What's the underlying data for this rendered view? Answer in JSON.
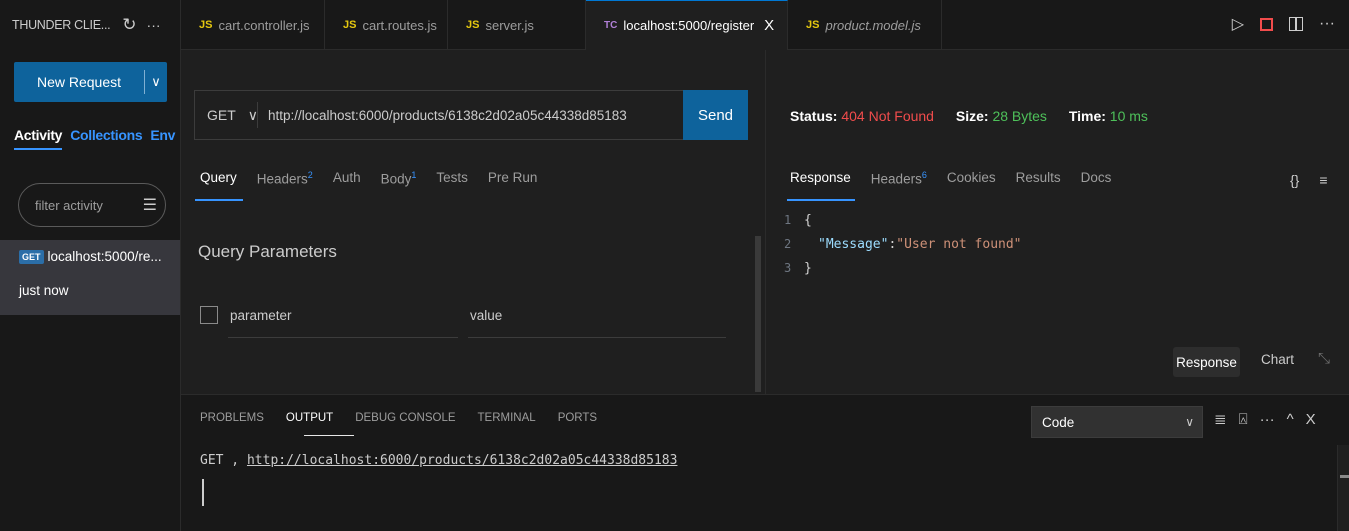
{
  "sidebar": {
    "title": "THUNDER CLIE...",
    "refresh_icon": "refresh-icon",
    "more_icon": "ellipsis-icon",
    "new_request_label": "New Request",
    "dropdown_glyph": "∨",
    "tabs": [
      "Activity",
      "Collections",
      "Env"
    ],
    "filter_placeholder": "filter activity",
    "activity": {
      "method": "GET",
      "label": "localhost:5000/re...",
      "time": "just now"
    }
  },
  "editor_tabs": [
    {
      "icon": "JS",
      "label": "cart.controller.js"
    },
    {
      "icon": "JS",
      "label": "cart.routes.js"
    },
    {
      "icon": "JS",
      "label": "server.js"
    },
    {
      "icon": "TC",
      "label": "localhost:5000/register",
      "active": true,
      "close": "X"
    },
    {
      "icon": "JS",
      "label": "product.model.js",
      "italic": true
    }
  ],
  "request": {
    "method": "GET",
    "url": "http://localhost:6000/products/6138c2d02a05c44338d85183",
    "send_label": "Send",
    "tabs": {
      "query": "Query",
      "headers": "Headers",
      "headers_count": "2",
      "auth": "Auth",
      "body": "Body",
      "body_count": "1",
      "tests": "Tests",
      "prerun": "Pre Run"
    },
    "query_title": "Query Parameters",
    "param_placeholder": "parameter",
    "value_placeholder": "value"
  },
  "response": {
    "status_label": "Status:",
    "status_value": "404 Not Found",
    "size_label": "Size:",
    "size_value": "28 Bytes",
    "time_label": "Time:",
    "time_value": "10 ms",
    "tabs": {
      "response": "Response",
      "headers": "Headers",
      "headers_count": "6",
      "cookies": "Cookies",
      "results": "Results",
      "docs": "Docs"
    },
    "braces_icon": "{}",
    "menu_icon": "≡",
    "code": {
      "line1": "{",
      "key": "\"Message\"",
      "colon": ": ",
      "value": "\"User not found\"",
      "line3": "}"
    },
    "view_response": "Response",
    "view_chart": "Chart"
  },
  "panel": {
    "tabs": [
      "PROBLEMS",
      "OUTPUT",
      "DEBUG CONSOLE",
      "TERMINAL",
      "PORTS"
    ],
    "select_value": "Code",
    "output_prefix": "GET , ",
    "output_link": "http://localhost:6000/products/6138c2d02a05c44338d85183"
  },
  "colors": {
    "accent": "#0e639c",
    "status_error": "#f14c4c",
    "status_ok": "#4ec05a",
    "link": "#3794ff"
  }
}
